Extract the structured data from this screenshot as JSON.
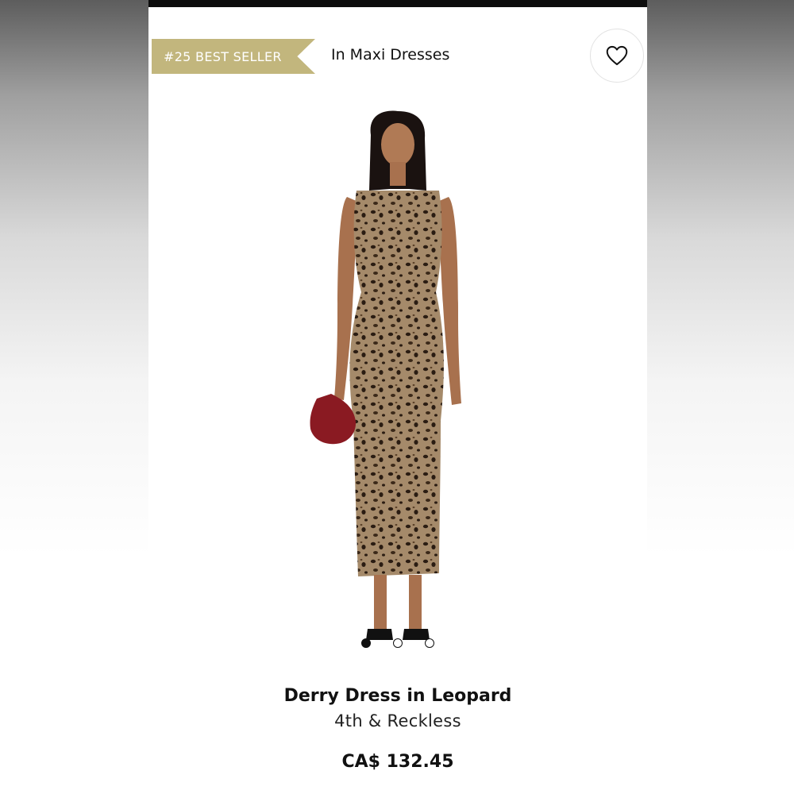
{
  "header": {
    "badge_text": "#25 BEST SELLER",
    "category_text": "In Maxi Dresses",
    "wishlist_icon": "heart-icon"
  },
  "gallery": {
    "image_count": 3,
    "active_index": 0
  },
  "product": {
    "name": "Derry Dress in Leopard",
    "brand": "4th & Reckless",
    "price": "CA$ 132.45"
  },
  "colors": {
    "badge_bg": "#c2b67d",
    "text": "#111111",
    "dress_base": "#a08668",
    "bag": "#8a1a22"
  }
}
